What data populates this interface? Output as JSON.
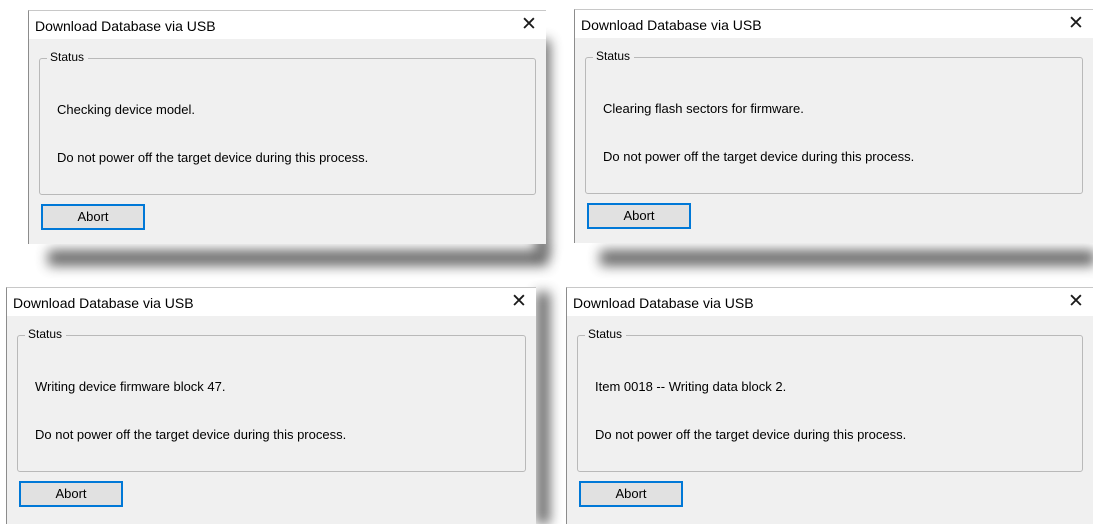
{
  "dialogs": [
    {
      "title": "Download Database via USB",
      "close_glyph": "✕",
      "group_label": "Status",
      "status_line": "Checking device model.",
      "warning_line": "Do not power off the target device during this process.",
      "abort_label": "Abort"
    },
    {
      "title": "Download Database via USB",
      "close_glyph": "✕",
      "group_label": "Status",
      "status_line": "Clearing flash sectors for firmware.",
      "warning_line": "Do not power off the target device during this process.",
      "abort_label": "Abort"
    },
    {
      "title": "Download Database via USB",
      "close_glyph": "✕",
      "group_label": "Status",
      "status_line": "Writing device firmware block 47.",
      "warning_line": "Do not power off the target device during this process.",
      "abort_label": "Abort"
    },
    {
      "title": "Download Database via USB",
      "close_glyph": "✕",
      "group_label": "Status",
      "status_line": "Item 0018 -- Writing data block 2.",
      "warning_line": "Do not power off the target device during this process.",
      "abort_label": "Abort"
    }
  ],
  "icons": {
    "close": "close-icon"
  },
  "colors": {
    "dialog_background": "#f0f0f0",
    "titlebar_background": "#ffffff",
    "focus_border": "#0078d7",
    "button_face": "#e1e1e1",
    "group_border": "#b9b9b9"
  }
}
